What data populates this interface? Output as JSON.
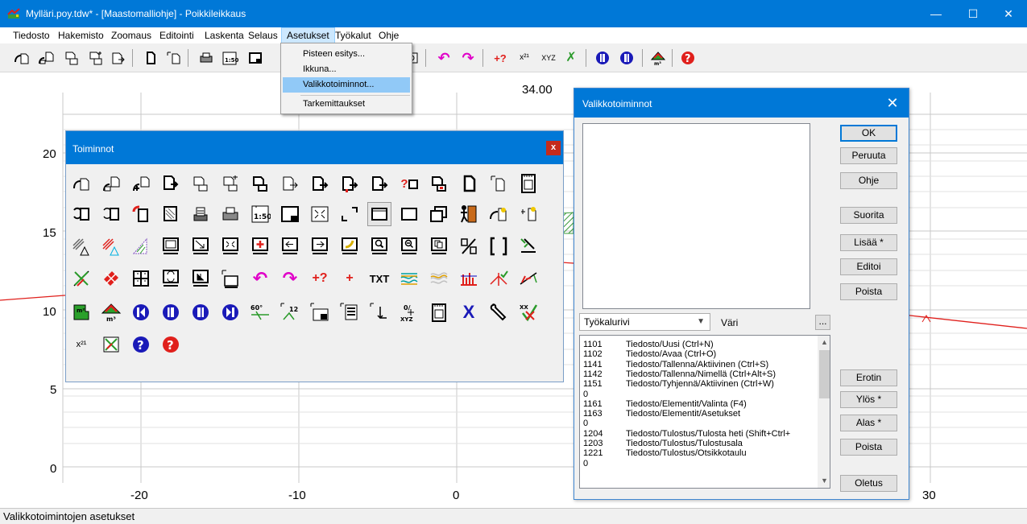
{
  "window": {
    "title": "Mylläri.poy.tdw* - [Maastomalliohje] - Poikkileikkaus",
    "minimize_glyph": "—",
    "maximize_glyph": "☐",
    "close_glyph": "✕"
  },
  "menubar": {
    "items": [
      "Tiedosto",
      "Hakemisto",
      "Zoomaus",
      "Editointi",
      "Laskenta",
      "Selaus",
      "Asetukset",
      "Työkalut",
      "Ohje"
    ],
    "active": "Asetukset"
  },
  "asetukset_menu": {
    "items": [
      "Pisteen esitys...",
      "Ikkuna...",
      "Valikkotoiminnot...",
      "Tarkemittaukset"
    ],
    "highlighted": "Valikkotoiminnot..."
  },
  "toolbar": {
    "icons": [
      "new-icon",
      "open-icon",
      "save-icon",
      "save-as-icon",
      "clear-icon",
      "element-select-icon",
      "element-settings-icon",
      "print-icon",
      "print-scale-icon",
      "print-area-icon",
      "zoom-window-icon",
      "undo-icon",
      "redo-icon",
      "insert-point-icon",
      "numbering-icon",
      "xyz-icon",
      "delete-all-icon",
      "prev-icon",
      "next-icon",
      "volume-icon",
      "help-icon"
    ],
    "scale_text": "1:50",
    "xyz_text": "XYZ"
  },
  "graph": {
    "top_label": "34.00",
    "y_ticks": [
      "20",
      "15",
      "10",
      "5",
      "0"
    ],
    "x_ticks": [
      "-20",
      "-10",
      "0",
      "30"
    ]
  },
  "toiminnot": {
    "title": "Toiminnot",
    "close": "x",
    "texts": {
      "scale": "1:50",
      "txt": "TXT",
      "m2": "m²",
      "m3": "m³",
      "deg": "60°",
      "xyz": "XYZ"
    }
  },
  "valikkotoiminnot": {
    "title": "Valikkotoiminnot",
    "close": "✕",
    "buttons": {
      "ok": "OK",
      "peruuta": "Peruuta",
      "ohje": "Ohje",
      "suorita": "Suorita",
      "lisaa": "Lisää *",
      "editoi": "Editoi",
      "poista1": "Poista",
      "erotin": "Erotin",
      "ylos": "Ylös *",
      "alas": "Alas *",
      "poista2": "Poista",
      "oletus": "Oletus"
    },
    "combo_value": "Työkalurivi",
    "color_label": "Väri",
    "dots": "...",
    "commands": [
      {
        "code": "1101",
        "desc": "Tiedosto/Uusi (Ctrl+N)"
      },
      {
        "code": "1102",
        "desc": "Tiedosto/Avaa (Ctrl+O)"
      },
      {
        "code": "1141",
        "desc": "Tiedosto/Tallenna/Aktiivinen (Ctrl+S)"
      },
      {
        "code": "1142",
        "desc": "Tiedosto/Tallenna/Nimellä (Ctrl+Alt+S)"
      },
      {
        "code": "1151",
        "desc": "Tiedosto/Tyhjennä/Aktiivinen (Ctrl+W)"
      },
      {
        "code": "0",
        "desc": ""
      },
      {
        "code": "1161",
        "desc": "Tiedosto/Elementit/Valinta (F4)"
      },
      {
        "code": "1163",
        "desc": "Tiedosto/Elementit/Asetukset"
      },
      {
        "code": "0",
        "desc": ""
      },
      {
        "code": "1204",
        "desc": "Tiedosto/Tulostus/Tulosta heti (Shift+Ctrl+"
      },
      {
        "code": "1203",
        "desc": "Tiedosto/Tulostus/Tulostusala"
      },
      {
        "code": "1221",
        "desc": "Tiedosto/Tulostus/Otsikkotaulu"
      },
      {
        "code": "0",
        "desc": ""
      }
    ]
  },
  "statusbar": {
    "text": "Valikkotoimintojen asetukset"
  },
  "colors": {
    "accent": "#0078d7",
    "profile_line": "#e0201c",
    "hatch": "#3a9a3a",
    "highlight": "#91c9f7"
  }
}
